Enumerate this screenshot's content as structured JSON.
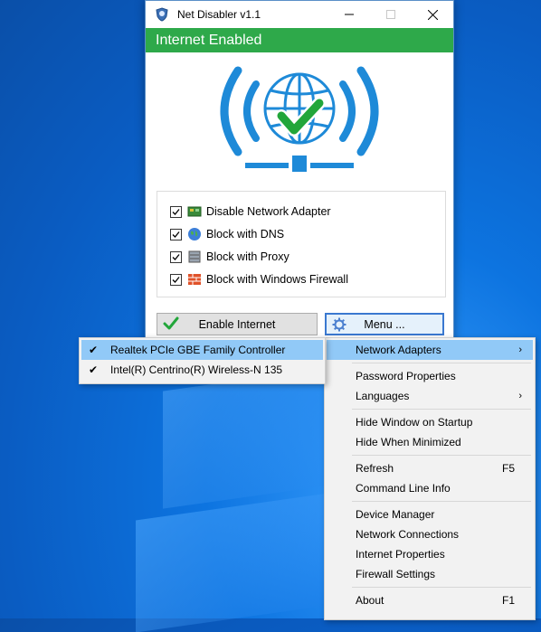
{
  "window": {
    "title": "Net Disabler v1.1",
    "status": "Internet Enabled",
    "status_color": "#2ea94a"
  },
  "options": [
    {
      "label": "Disable Network Adapter",
      "checked": true,
      "icon": "network-adapter-icon"
    },
    {
      "label": "Block with DNS",
      "checked": true,
      "icon": "globe-icon"
    },
    {
      "label": "Block with Proxy",
      "checked": true,
      "icon": "server-icon"
    },
    {
      "label": "Block with Windows Firewall",
      "checked": true,
      "icon": "firewall-icon"
    }
  ],
  "buttons": {
    "enable_label": "Enable Internet",
    "menu_label": "Menu ..."
  },
  "menu": {
    "items": [
      {
        "label": "Network Adapters",
        "submenu": true,
        "highlighted": true
      },
      {
        "label": "Password Properties"
      },
      {
        "label": "Languages",
        "submenu": true
      },
      {
        "label": "Hide Window on Startup"
      },
      {
        "label": "Hide When Minimized"
      },
      {
        "label": "Refresh",
        "shortcut": "F5"
      },
      {
        "label": "Command Line Info"
      },
      {
        "label": "Device Manager"
      },
      {
        "label": "Network Connections"
      },
      {
        "label": "Internet Properties"
      },
      {
        "label": "Firewall Settings"
      },
      {
        "label": "About",
        "shortcut": "F1"
      }
    ]
  },
  "submenu": {
    "items": [
      {
        "label": "Realtek PCIe GBE Family Controller",
        "checked": true,
        "highlighted": true
      },
      {
        "label": "Intel(R) Centrino(R) Wireless-N 135",
        "checked": true
      }
    ]
  }
}
